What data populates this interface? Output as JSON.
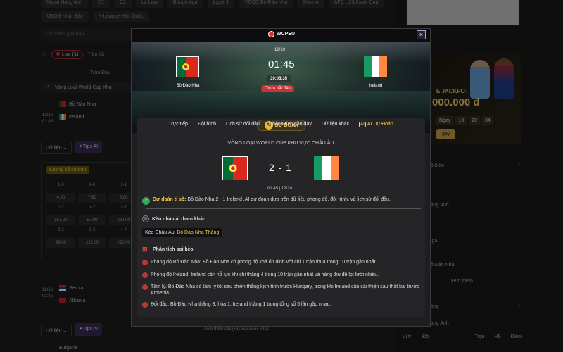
{
  "background": {
    "chips_row1": [
      "Ngoại Hạng Anh",
      "C1",
      "C2",
      "La Liga",
      "Bundesliga",
      "Ligue 1",
      "VĐQG Bồ Đào Nha",
      "Serie A",
      "AFC U23 Asian Cup"
    ],
    "chips_row2": [
      "VĐQG Nhật Bản",
      "K-League Hàn Quốc"
    ],
    "search_placeholder": "Tìm kiếm giải đấu",
    "live_label": "Live (1)",
    "odd_label": "Trận đã",
    "col_header": "Trận Đấu",
    "league_name": "Vòng Loại World Cup Khu",
    "match1": {
      "home": "Bồ Đào Nha",
      "away": "Ireland",
      "date": "12/10",
      "time": "01:45"
    },
    "btn_data": "Dữ liệu",
    "btn_ai": "Tips AI",
    "odds_title": "Kèo tỷ số cả trận",
    "odds": [
      {
        "h": "1-0",
        "v": "4.80"
      },
      {
        "h": "2-0",
        "v": "7.60"
      },
      {
        "h": "2-1",
        "v": "8.80"
      },
      {
        "h": "0-7",
        "v": "157.00"
      },
      {
        "h": "1-7",
        "v": "57.00"
      },
      {
        "h": "2-7",
        "v": "222.00"
      },
      {
        "h": "2-2",
        "v": "39.00"
      },
      {
        "h": "3-3",
        "v": "222.00"
      },
      {
        "h": "4-4",
        "v": "222.00"
      }
    ],
    "match2": {
      "home": "Serbia",
      "away": "Albania",
      "date": "12/10",
      "time": "01:45"
    },
    "more_odds": "Xem thêm các (+1) loại cược khác",
    "team_bottom": "Bulgaria",
    "right": {
      "jackpot": "E JACKPOT",
      "amount": "000.000 đ",
      "countdown": [
        "Ngày",
        "13",
        "20",
        "34"
      ],
      "play_btn": "gay",
      "bxh": "ô biến",
      "items": [
        "ạng Anh",
        "iga",
        "ồ Đào Nha"
      ],
      "see_more": "Xem thêm",
      "table_title": "ảng",
      "table_league": "ạng Anh",
      "table_cols": [
        "Vị trí",
        "Đội",
        "Trận",
        "HS",
        "Điểm"
      ]
    }
  },
  "modal": {
    "brand": "WCPEU",
    "close": "×",
    "date": "12/10",
    "score_time": "01:45",
    "timer": "39:05:35",
    "status": "Chưa bắt đầu",
    "home": "Bồ Đào Nha",
    "away": "Ireland",
    "tabs": [
      "Trực tiếp",
      "Đội hình",
      "Lịch sử đối đầu",
      "Thành tích gần đây",
      "Dữ liệu khác",
      "AI Dự Đoán"
    ],
    "tab_ai_icon": "AI",
    "pill_icon": "AI",
    "pill_label": "DỰ ĐOÁN",
    "competition": "VÒNG LOẠI WORLD CUP KHU VỰC CHÂU ÂU",
    "score": "2 - 1",
    "match_time": "01:45 | 12/10",
    "prediction_label": "Dự đoán tỉ số:",
    "prediction_text": "Bồ Đào Nha 2 - 1 Ireland ,AI dự đoán dựa trên dữ liệu phong độ, đội hình, và lịch sử đối đầu.",
    "keo_title": "Kèo nhà cái tham khảo",
    "keo_label": "Kèo Châu Âu:",
    "keo_value": "Bồ Đào Nha Thắng",
    "analysis_title": "Phân tích soi kèo",
    "analysis": [
      "Phong độ Bồ Đào Nha: Bồ Đào Nha có phong độ khá ổn định với chỉ 1 trận thua trong 10 trận gần nhất.",
      "Phong độ Ireland: Ireland cần nỗ lực khi chỉ thắng 4 trong 10 trận gần nhất và hàng thủ để lọt lưới nhiều.",
      "Tâm lý: Bồ Đào Nha có tâm lý tốt sau chiến thắng kịch tính trước Hungary, trong khi Ireland cần cải thiện sau thất bại trước Armenia.",
      "Đối đầu: Bồ Đào Nha thắng 3, hòa 1. Ireland thắng 1 trong tổng số 5 lần gặp nhau."
    ]
  },
  "colors": {
    "accent": "#f5d04a",
    "status_red": "#c9343b",
    "check_green": "#3aa35a"
  }
}
